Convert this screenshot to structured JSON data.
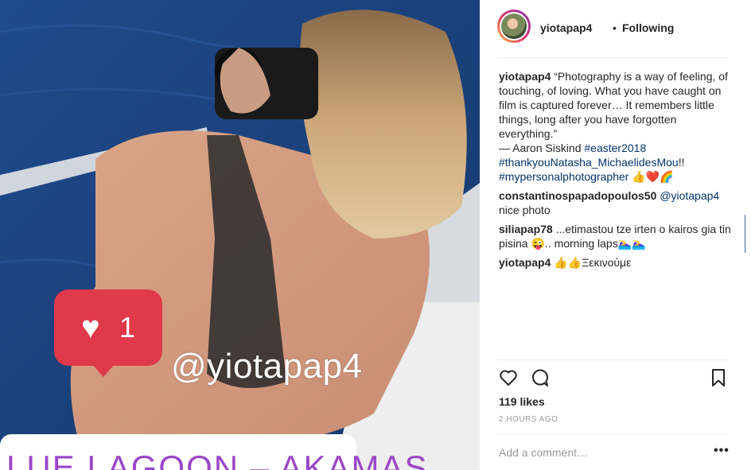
{
  "photo": {
    "overlay_handle": "@yiotapap4",
    "like_count": "1",
    "location_text": "LUE LAGOON – AKAMAS"
  },
  "header": {
    "username": "yiotapap4",
    "separator": "•",
    "follow_label": "Following"
  },
  "caption": {
    "author": "yiotapap4",
    "text": "“Photography is a way of feeling, of touching, of loving. What you have caught on film is captured forever… It remembers little things, long after you have forgotten everything.”",
    "attribution": "— Aaron Siskind",
    "tags": [
      "#easter2018",
      "#thankyouNatasha_MichaelidesMou",
      "#mypersonalphotographer"
    ],
    "tag_suffix": "!!",
    "emoji_trail": "👍❤️🌈"
  },
  "comments": [
    {
      "user": "constantinospapadopoulos50",
      "mention": "@yiotapap4",
      "text": "nice photo"
    },
    {
      "user": "siliapap78",
      "text": "...etimastou tze irten o kairos gia tin pisina 😜.. morning laps🏊‍♀️🏊‍♀️"
    },
    {
      "user": "yiotapap4",
      "text": "👍👍Ξεκινούμε"
    }
  ],
  "actions": {
    "like_icon": "heart-icon",
    "comment_icon": "comment-icon",
    "save_icon": "bookmark-icon"
  },
  "likes_text": "119 likes",
  "time_text": "2 HOURS AGO",
  "comment_box": {
    "placeholder": "Add a comment…",
    "more_label": "•••"
  }
}
